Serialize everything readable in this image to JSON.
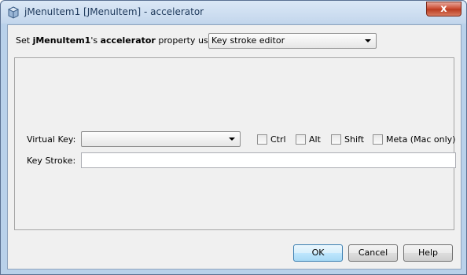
{
  "window": {
    "title": "jMenuItem1 [JMenuItem] - accelerator",
    "close_glyph": "x"
  },
  "header": {
    "prefix": "Set ",
    "component": "jMenuItem1",
    "possessive": "'s ",
    "property": "accelerator",
    "suffix": " property using:",
    "editor_select_value": "Key stroke editor"
  },
  "form": {
    "virtual_key_label": "Virtual Key:",
    "virtual_key_value": "",
    "modifiers": [
      {
        "label": "Ctrl",
        "checked": false
      },
      {
        "label": "Alt",
        "checked": false
      },
      {
        "label": "Shift",
        "checked": false
      },
      {
        "label": "Meta (Mac only)",
        "checked": false
      }
    ],
    "key_stroke_label": "Key Stroke:",
    "key_stroke_value": ""
  },
  "buttons": {
    "ok": "OK",
    "cancel": "Cancel",
    "help": "Help"
  }
}
